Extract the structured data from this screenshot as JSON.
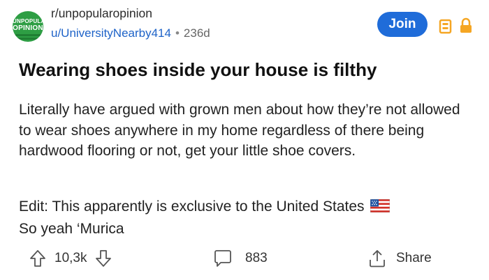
{
  "header": {
    "subreddit_icon": {
      "line1": "UNPOPULAR",
      "line2": "OPINION",
      "color": "#2e9e44"
    },
    "subreddit": "r/unpopularopinion",
    "username": "u/UniversityNearby414",
    "separator": "•",
    "age": "236d",
    "join_label": "Join",
    "status_icons": [
      "battery-icon",
      "lock-icon"
    ],
    "accent_color": "#f5a623"
  },
  "post": {
    "title": "Wearing shoes inside your house is filthy",
    "body": "Literally have argued with grown men about how they’re not allowed to wear shoes anywhere in my home regardless of there being hardwood flooring or not, get your little shoe covers.",
    "edit_line1": "Edit: This apparently is exclusive to the United States",
    "edit_line2": "So yeah ‘Murica",
    "edit_icon": "us-flag-icon"
  },
  "actions": {
    "score": "10,3k",
    "comments": "883",
    "share_label": "Share",
    "icons": [
      "upvote-icon",
      "downvote-icon",
      "comment-icon",
      "share-icon"
    ]
  },
  "colors": {
    "link": "#1e63c8",
    "join_bg": "#1f6cd9",
    "subreddit_green": "#2e9e44"
  }
}
